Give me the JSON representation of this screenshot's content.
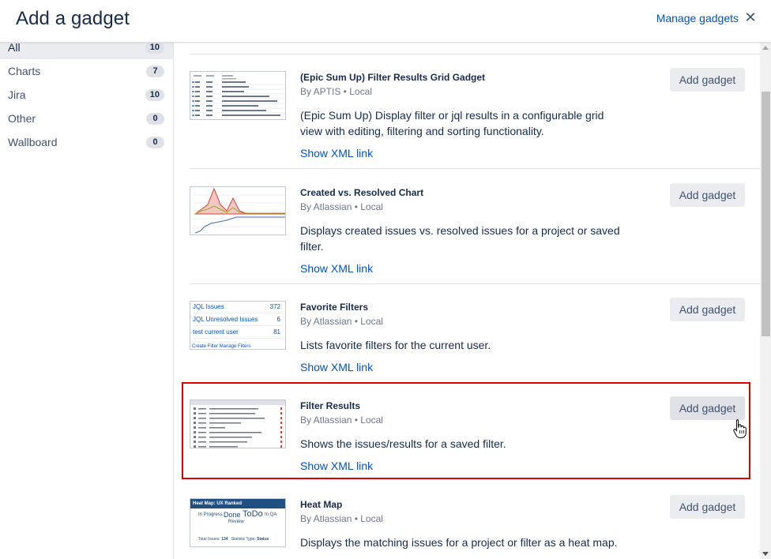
{
  "header": {
    "title": "Add a gadget",
    "manage_link": "Manage gadgets",
    "close_glyph": "✕"
  },
  "sidebar": {
    "items": [
      {
        "label": "All",
        "count": "10"
      },
      {
        "label": "Charts",
        "count": "7"
      },
      {
        "label": "Jira",
        "count": "10"
      },
      {
        "label": "Other",
        "count": "0"
      },
      {
        "label": "Wallboard",
        "count": "0"
      }
    ]
  },
  "gadgets": [
    {
      "name": "(Epic Sum Up) Filter Results Grid Gadget",
      "by": "By APTIS • Local",
      "desc": "(Epic Sum Up) Display filter or jql results in a configurable grid view with editing, filtering and sorting functionality.",
      "link": "Show XML link",
      "button": "Add gadget",
      "thumb_icon": "grid-gadget-thumbnail"
    },
    {
      "name": "Created vs. Resolved Chart",
      "by": "By Atlassian • Local",
      "desc": "Displays created issues vs. resolved issues for a project or saved filter.",
      "link": "Show XML link",
      "button": "Add gadget",
      "thumb_icon": "line-chart-thumbnail"
    },
    {
      "name": "Favorite Filters",
      "by": "By Atlassian • Local",
      "desc": "Lists favorite filters for the current user.",
      "link": "Show XML link",
      "button": "Add gadget",
      "thumb_icon": "favorite-filters-thumbnail",
      "thumb": {
        "rows": [
          {
            "label": "JQL Issues",
            "count": "372"
          },
          {
            "label": "JQL Unresolved Issues",
            "count": "6"
          },
          {
            "label": "test current user",
            "count": "81"
          }
        ],
        "links": "Create Filter     Manage Filters"
      }
    },
    {
      "name": "Filter Results",
      "by": "By Atlassian • Local",
      "desc": "Shows the issues/results for a saved filter.",
      "link": "Show XML link",
      "button": "Add gadget",
      "thumb_icon": "issue-table-thumbnail",
      "highlighted": true
    },
    {
      "name": "Heat Map",
      "by": "By Atlassian • Local",
      "desc": "Displays the matching issues for a project or filter as a heat map.",
      "link": "Show XML link",
      "button": "Add gadget",
      "thumb_icon": "heat-map-thumbnail",
      "thumb": {
        "head": "Heat Map: UX Ranked",
        "words": [
          "In Progress",
          "Done",
          "ToDo",
          "In QA",
          "Review"
        ],
        "footer_left": "Total Issues:",
        "footer_total": "134",
        "footer_mid": "Statistic Type:",
        "footer_stat": "Status"
      }
    }
  ],
  "colors": {
    "link": "#0052cc",
    "highlight_border": "#dd0000",
    "button_bg": "#ebecf0"
  },
  "cursor_icon": "hand-pointer-icon"
}
